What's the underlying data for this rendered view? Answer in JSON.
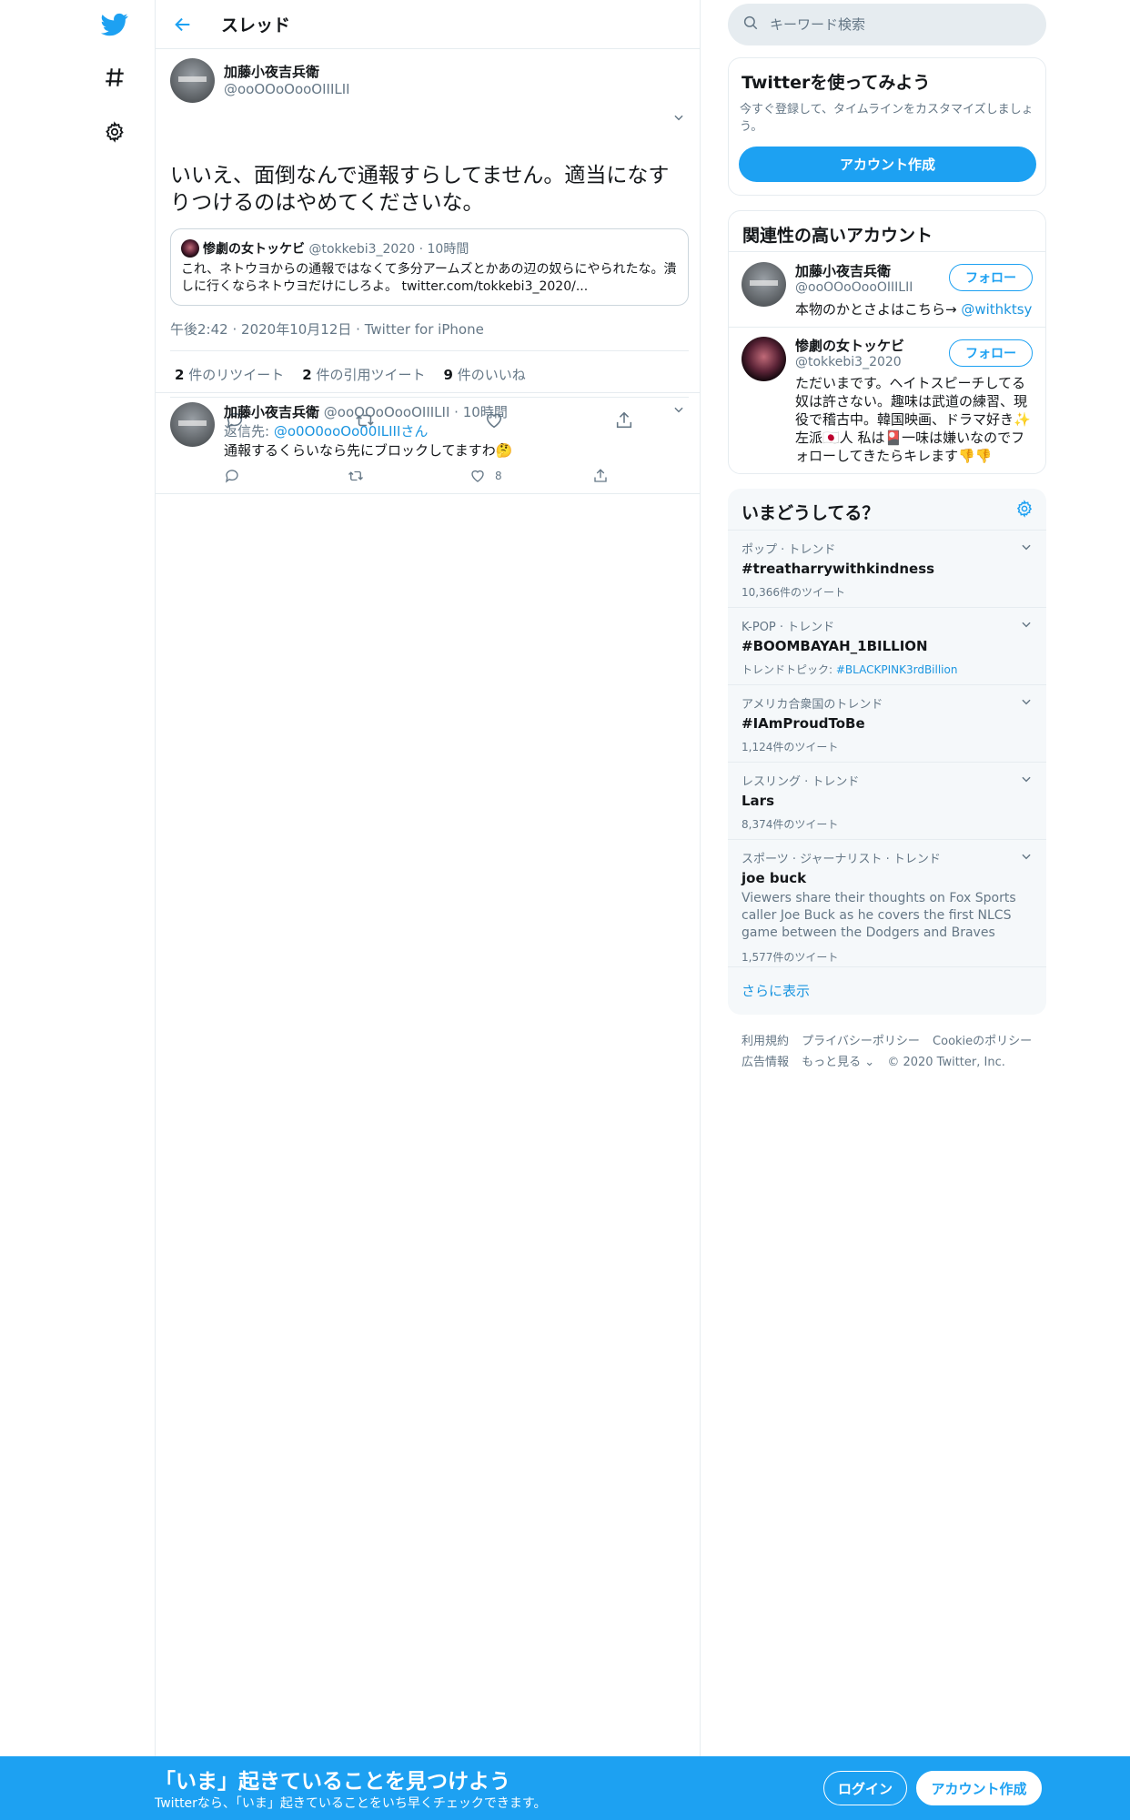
{
  "colors": {
    "brand": "#1da1f2",
    "text": "#14171a",
    "muted": "#657786",
    "link": "#1b95e0"
  },
  "nav": {
    "logo_icon": "twitter-bird-icon",
    "explore_icon": "hashtag-icon",
    "settings_icon": "gear-icon"
  },
  "thread": {
    "title": "スレッド",
    "main_tweet": {
      "name": "加藤小夜吉兵衛",
      "handle": "@ooOOoOooOIIILII",
      "text": "いいえ、面倒なんで通報すらしてません。適当になすりつけるのはやめてくださいな。",
      "quote": {
        "name": "惨劇の女トッケビ",
        "handle": "@tokkebi3_2020",
        "time": "10時間",
        "text": "これ、ネトウヨからの通報ではなくて多分アームズとかあの辺の奴らにやられたな。潰しに行くならネトウヨだけにしろよ。",
        "link": "twitter.com/tokkebi3_2020/..."
      },
      "time": "午後2:42",
      "date": "2020年10月12日",
      "source": "Twitter for iPhone",
      "retweets": "2",
      "retweets_label": "件のリツイート",
      "quotes": "2",
      "quotes_label": "件の引用ツイート",
      "likes": "9",
      "likes_label": "件のいいね"
    },
    "reply": {
      "name": "加藤小夜吉兵衛",
      "handle": "@ooOOoOooOIIILII",
      "time": "10時間",
      "reply_to_label": "返信先:",
      "reply_to_handle": "@o0O0ooOo00ILIIIさん",
      "text": "通報するくらいなら先にブロックしてますわ🤔",
      "like_count": "8"
    }
  },
  "sidebar": {
    "search_placeholder": "キーワード検索",
    "signup": {
      "title": "Twitterを使ってみよう",
      "desc": "今すぐ登録して、タイムラインをカスタマイズしましょう。",
      "button": "アカウント作成"
    },
    "related": {
      "title": "関連性の高いアカウント",
      "follow_label": "フォロー",
      "accounts": [
        {
          "name": "加藤小夜吉兵衛",
          "handle": "@ooOOoOooOIIILII",
          "bio": "本物のかとさよはこちら→ ",
          "bio_link": "@withktsy"
        },
        {
          "name": "惨劇の女トッケビ",
          "handle": "@tokkebi3_2020",
          "bio": "ただいまです。ヘイトスピーチしてる奴は許さない。趣味は武道の練習、現役で稽古中。韓国映画、ドラマ好き✨ 左派🇯🇵人 私は🎴一味は嫌いなのでフォローしてきたらキレます👎👎",
          "bio_link": ""
        }
      ]
    },
    "trends": {
      "title": "いまどうしてる？",
      "items": [
        {
          "category": "ポップ · トレンド",
          "name": "#treatharrywithkindness",
          "meta": "10,366件のツイート"
        },
        {
          "category": "K-POP · トレンド",
          "name": "#BOOMBAYAH_1BILLION",
          "meta_prefix": "トレンドトピック: ",
          "meta_link": "#BLACKPINK3rdBillion"
        },
        {
          "category": "アメリカ合衆国のトレンド",
          "name": "#IAmProudToBe",
          "meta": "1,124件のツイート"
        },
        {
          "category": "レスリング · トレンド",
          "name": "Lars",
          "meta": "8,374件のツイート"
        },
        {
          "category": "スポーツ · ジャーナリスト · トレンド",
          "name": "joe buck",
          "desc": "Viewers share their thoughts on Fox Sports caller Joe Buck as he covers the first NLCS game between the Dodgers and Braves",
          "meta": "1,577件のツイート"
        }
      ],
      "show_more": "さらに表示"
    },
    "footer": {
      "terms": "利用規約",
      "privacy": "プライバシーポリシー",
      "cookie": "Cookieのポリシー",
      "ads": "広告情報",
      "more": "もっと見る ⌄",
      "copyright": "© 2020 Twitter, Inc."
    }
  },
  "bottom_bar": {
    "title": "「いま」起きていることを見つけよう",
    "subtitle": "Twitterなら、「いま」起きていることをいち早くチェックできます。",
    "login": "ログイン",
    "signup": "アカウント作成"
  }
}
